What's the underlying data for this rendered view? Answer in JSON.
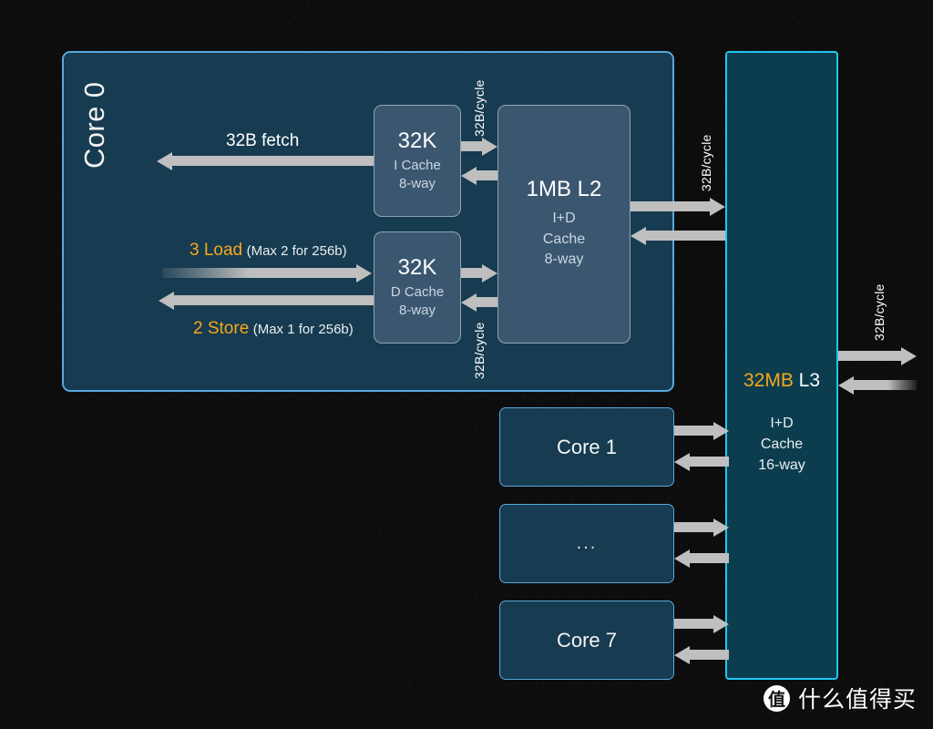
{
  "diagram": {
    "title": "CPU cache hierarchy block diagram",
    "colors": {
      "background": "#0d0d0d",
      "core_fill": "#173b50",
      "core_border": "#57a8dd",
      "cache_fill": "#3b5770",
      "cache_border": "#8ea4b6",
      "l3_fill": "#0c3d4e",
      "l3_border": "#22c6f0",
      "arrow": "#bfbfbf",
      "accent_amber": "#f5a81c",
      "text": "#ffffff"
    }
  },
  "core0": {
    "label": "Core 0",
    "fetch_label": "32B fetch",
    "load": {
      "count": "3 Load",
      "note": "(Max 2 for 256b)"
    },
    "store": {
      "count": "2 Store",
      "note": "(Max 1 for 256b)"
    },
    "icache": {
      "size": "32K",
      "kind": "I Cache",
      "assoc": "8-way"
    },
    "dcache": {
      "size": "32K",
      "kind": "D Cache",
      "assoc": "8-way"
    },
    "l2": {
      "size": "1MB L2",
      "line1": "I+D",
      "line2": "Cache",
      "line3": "8-way"
    }
  },
  "bandwidth": {
    "icache_to_l2": "32B/cycle",
    "dcache_to_l2": "32B/cycle",
    "l2_to_l3": "32B/cycle",
    "l3_to_memory": "32B/cycle"
  },
  "l3": {
    "size": "32MB",
    "level": "L3",
    "line1": "I+D",
    "line2": "Cache",
    "line3": "16-way"
  },
  "other_cores": [
    {
      "label": "Core 1"
    },
    {
      "label": "..."
    },
    {
      "label": "Core 7"
    }
  ],
  "watermark": {
    "logo_glyph": "值",
    "text": "什么值得买"
  }
}
